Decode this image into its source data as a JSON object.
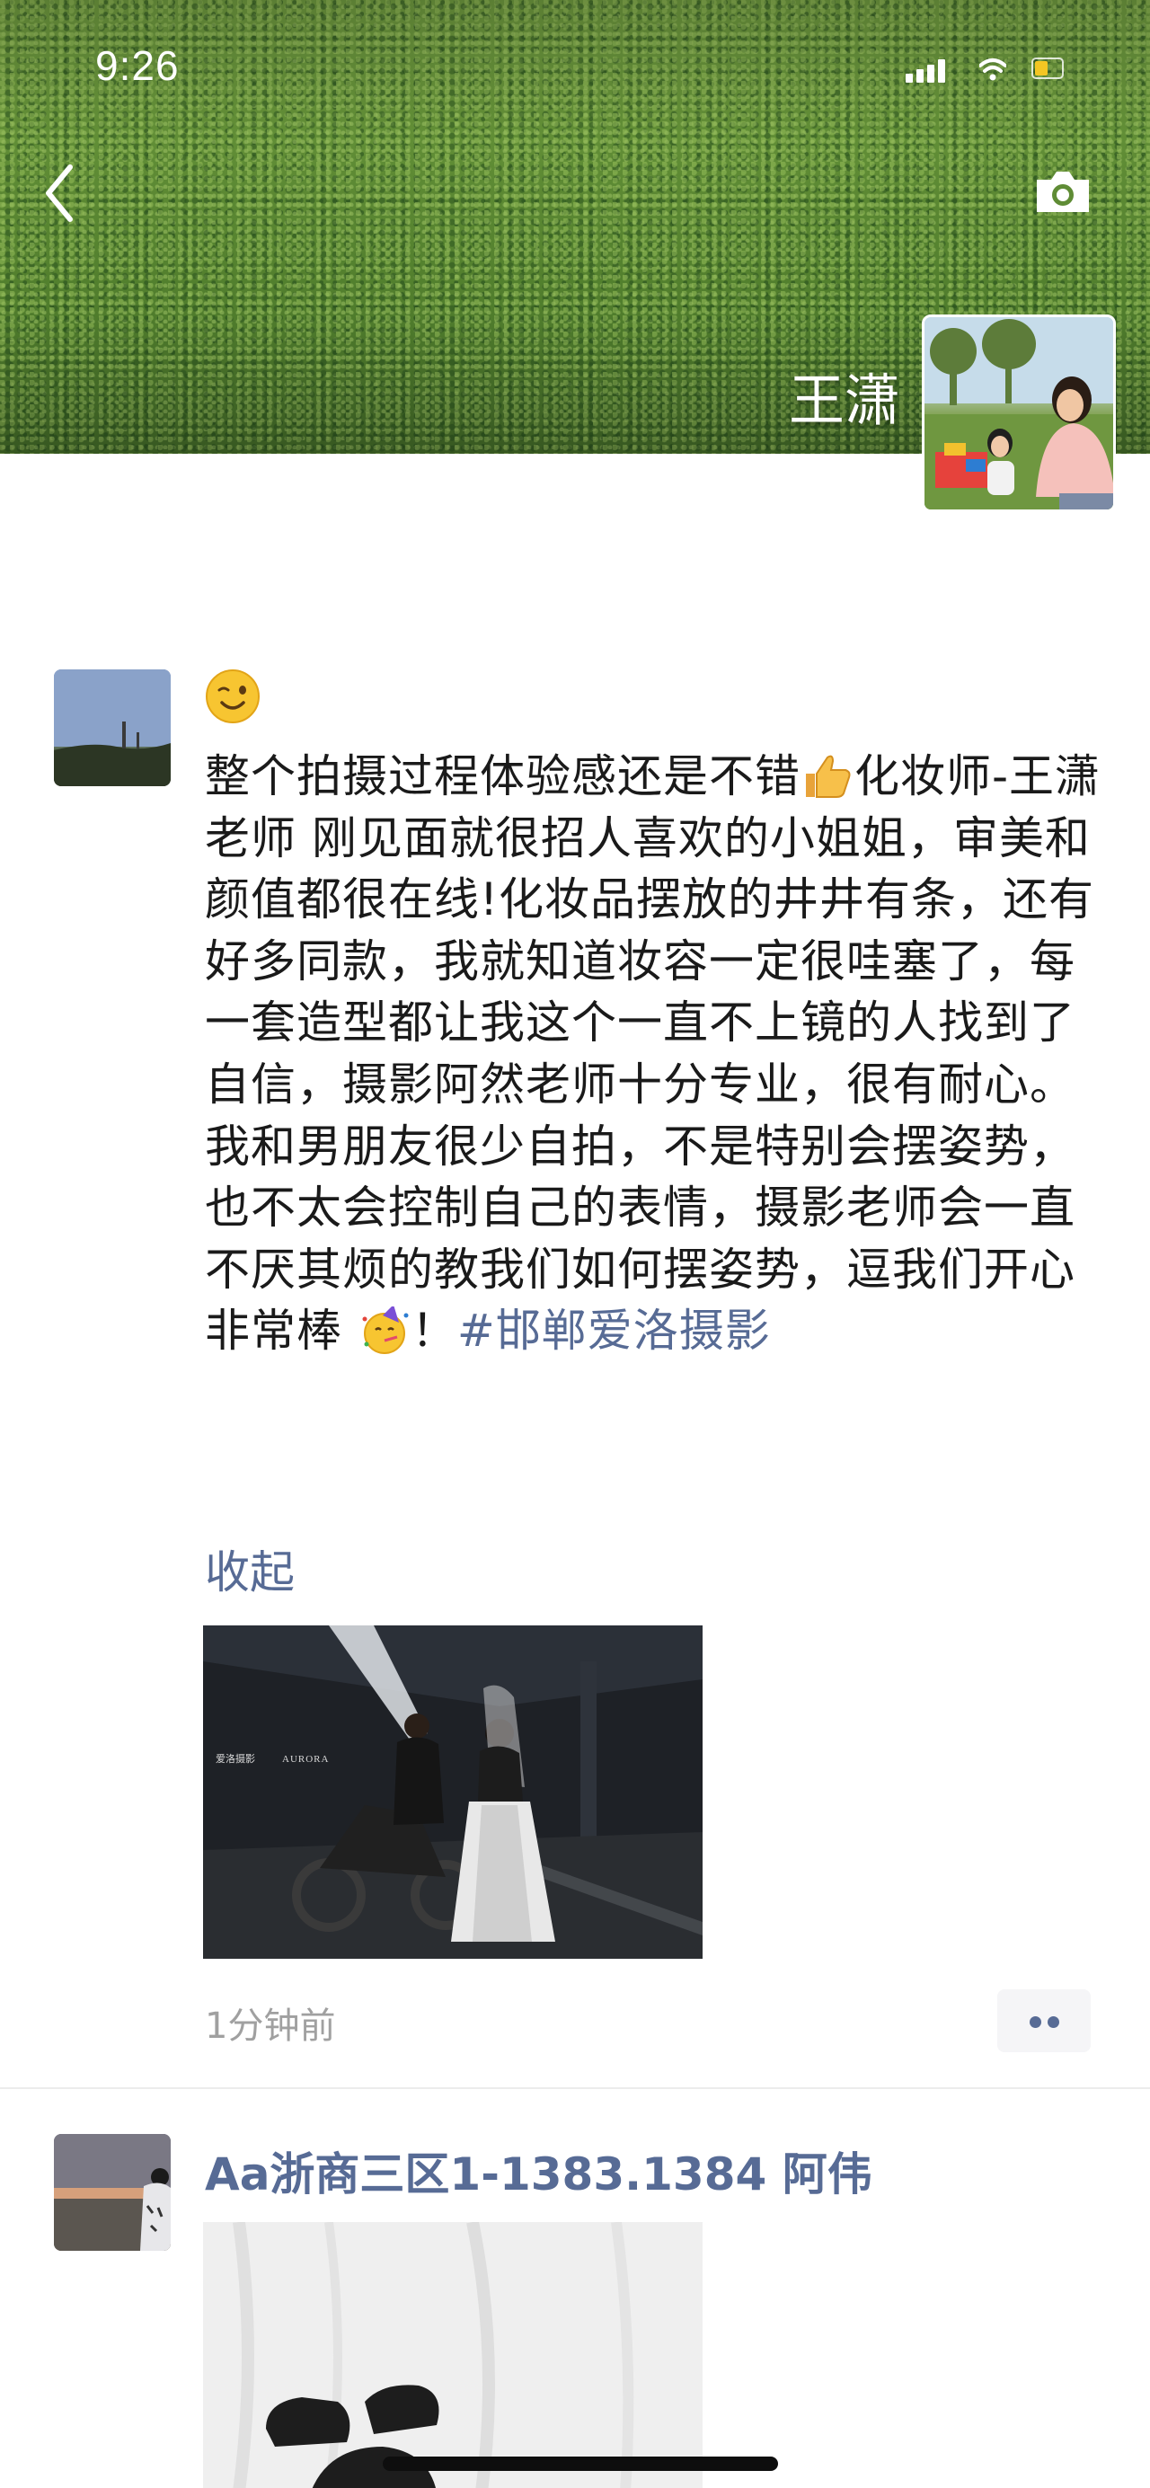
{
  "status_bar": {
    "time": "9:26"
  },
  "header": {
    "owner_name": "王潇"
  },
  "post1": {
    "emoji_icon": "winking-face-icon",
    "text_part1": "整个拍摄过程体验感还是不错",
    "text_icon1": "thumbs-up-icon",
    "text_part2": "化妆师-王潇老师 刚见面就很招人喜欢的小姐姐，审美和颜值都很在线!化妆品摆放的井井有条，还有好多同款，我就知道妆容一定很哇塞了，每一套造型都让我这个一直不上镜的人找到了自信，摄影阿然老师十分专业，很有耐心。我和男朋友很少自拍，不是特别会摆姿势，也不太会控制自己的表情，摄影老师会一直不厌其烦的教我们如何摆姿势，逗我们开心 非常棒 ",
    "text_icon2": "partying-face-icon",
    "text_part3": "！",
    "hashtag": "#邯郸爱洛摄影",
    "collapse_label": "收起",
    "photo_watermark_cn": "爱洛摄影",
    "photo_watermark_en": "AURORA",
    "time": "1分钟前"
  },
  "post2": {
    "author": "Aa浙商三区1-1383.1384 阿伟"
  },
  "colors": {
    "link": "#576b95",
    "time_gray": "#a0a0a0",
    "divider": "#ececec"
  }
}
